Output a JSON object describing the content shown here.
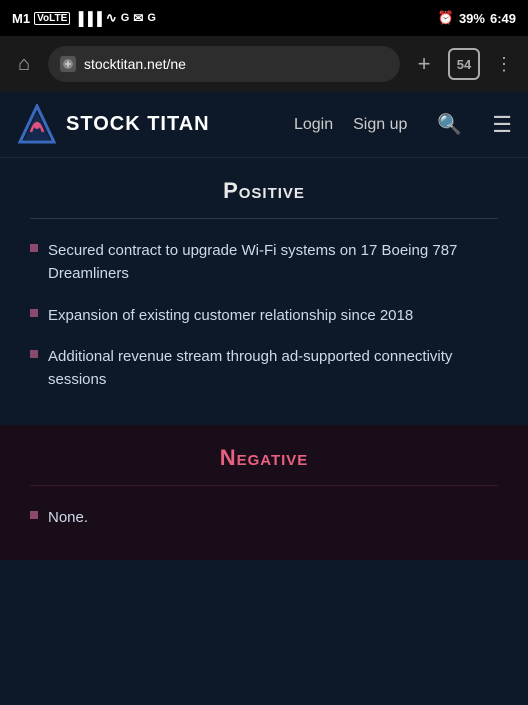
{
  "statusBar": {
    "carrier": "M1",
    "networkType": "VoLTE",
    "time": "6:49",
    "batteryPercent": "39"
  },
  "browser": {
    "url": "stocktitan.net/ne",
    "tabCount": "54",
    "homeIcon": "⌂",
    "addTabIcon": "+",
    "menuIcon": "⋮"
  },
  "siteHeader": {
    "logoText": "STOCK TITAN",
    "loginLabel": "Login",
    "signupLabel": "Sign up"
  },
  "positive": {
    "title": "Positive",
    "divider": true,
    "bullets": [
      "Secured contract to upgrade Wi-Fi systems on 17 Boeing 787 Dreamliners",
      "Expansion of existing customer relationship since 2018",
      "Additional revenue stream through ad-supported connectivity sessions"
    ]
  },
  "negative": {
    "title": "Negative",
    "divider": true,
    "bullets": [
      "None."
    ]
  }
}
